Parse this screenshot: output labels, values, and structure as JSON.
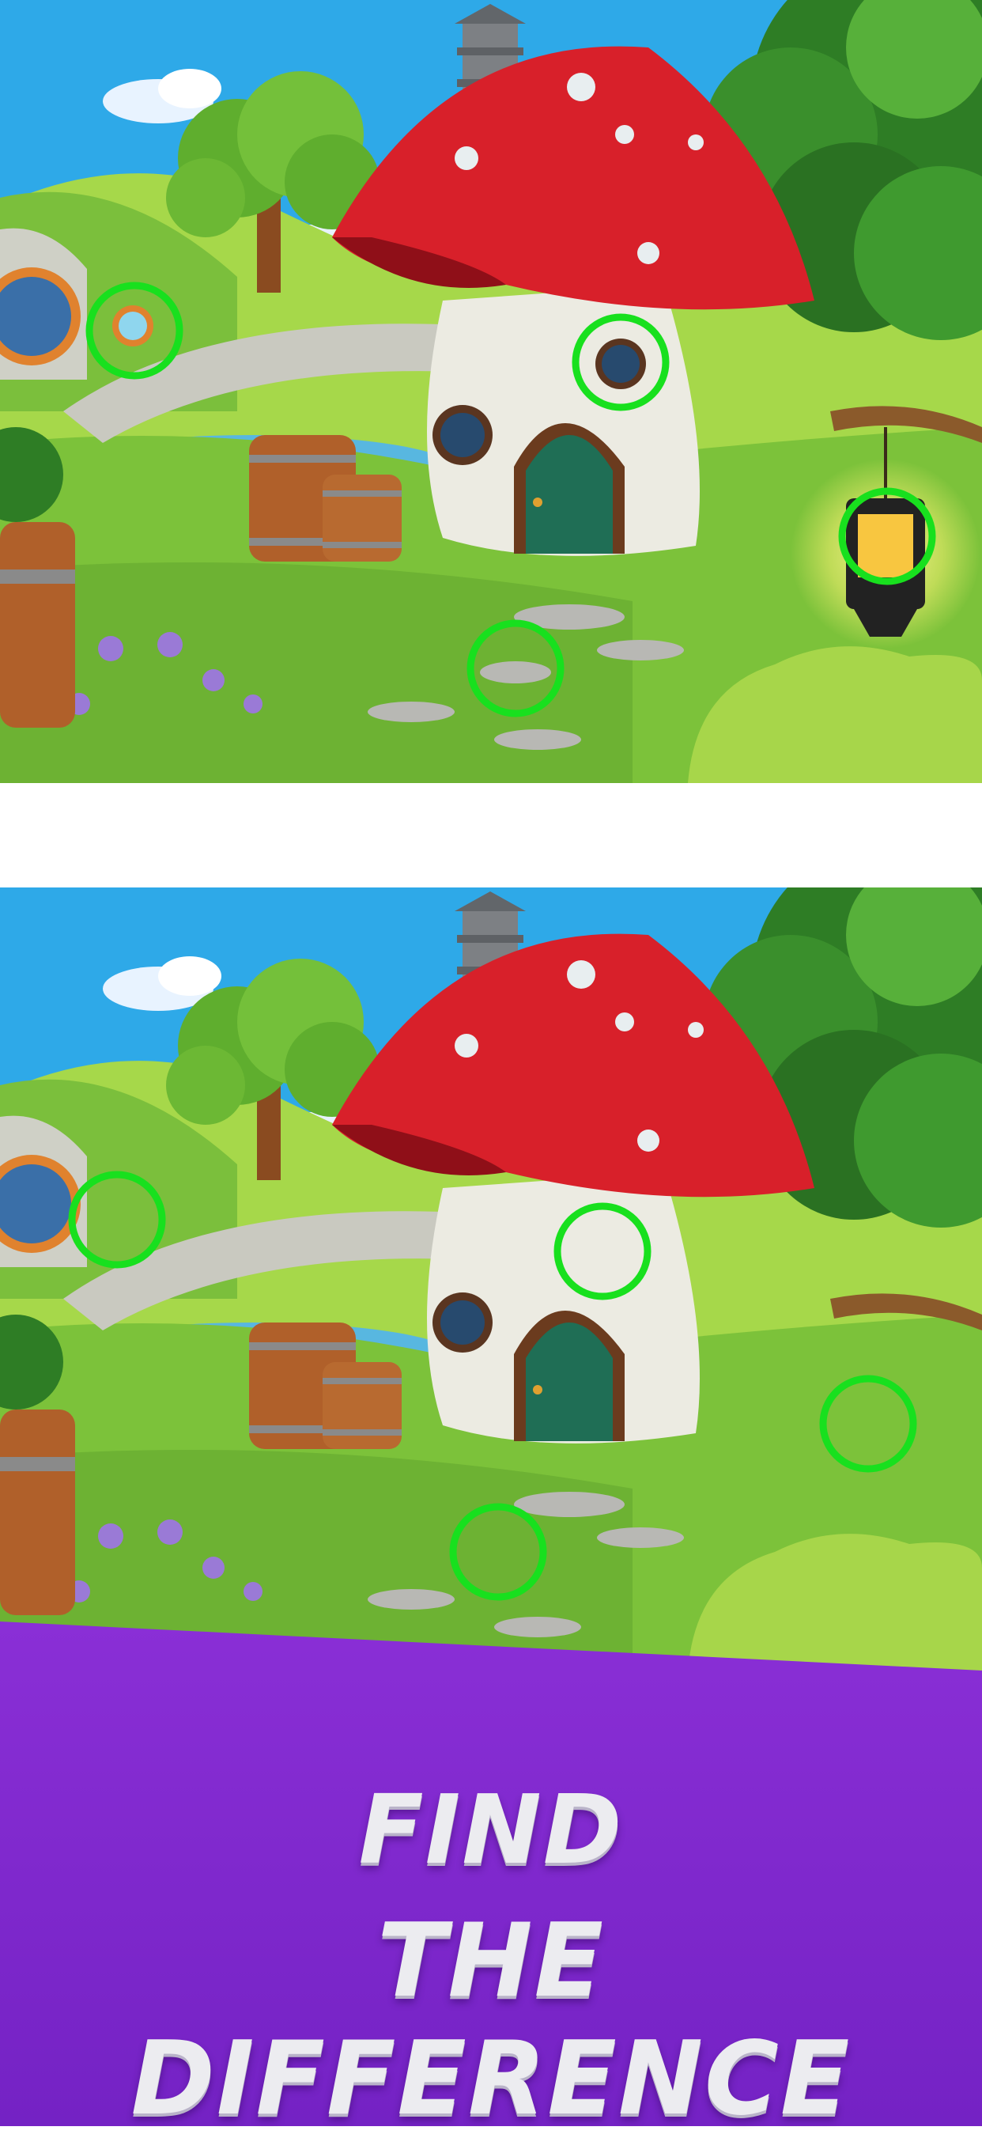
{
  "game": {
    "title_line1": "FIND",
    "title_line2": "THE DIFFERENCE"
  },
  "colors": {
    "banner": "#8a2fd6",
    "banner_dark": "#6d1fb5",
    "marker": "#18e01e",
    "sky": "#2ea9e8",
    "grass": "#7cc23a",
    "mushroom_cap": "#d8202a"
  },
  "panels": [
    {
      "name": "original",
      "shows": [
        "hobbit-round-window",
        "mushroom-upper-window",
        "stepping-stone",
        "hanging-lantern"
      ]
    },
    {
      "name": "modified",
      "shows": []
    }
  ],
  "found_markers": 4,
  "icons": [
    "found-circle-icon",
    "lantern-icon",
    "round-window-icon"
  ]
}
